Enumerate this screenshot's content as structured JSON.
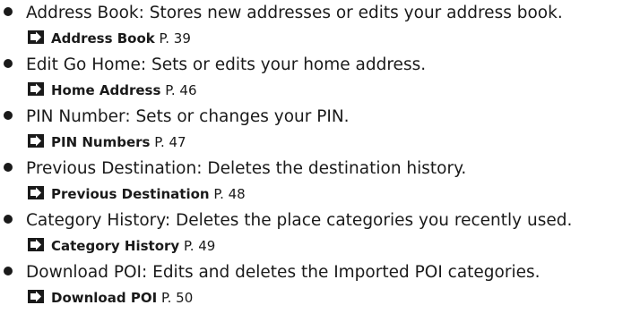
{
  "items": [
    {
      "term": "Address Book",
      "description": ": Stores new addresses or edits your address book.",
      "ref_title": "Address Book",
      "ref_page": "P. 39"
    },
    {
      "term": "Edit Go Home",
      "description": ": Sets or edits your home address.",
      "ref_title": "Home Address",
      "ref_page": "P. 46"
    },
    {
      "term": "PIN Number",
      "description": ": Sets or changes your PIN.",
      "ref_title": "PIN Numbers",
      "ref_page": "P. 47"
    },
    {
      "term": "Previous Destination",
      "description": ": Deletes the destination history.",
      "ref_title": "Previous Destination",
      "ref_page": "P. 48"
    },
    {
      "term": "Category History",
      "description": ": Deletes the place categories you recently used.",
      "ref_title": "Category History",
      "ref_page": "P. 49"
    },
    {
      "term": "Download POI",
      "description": ": Edits and deletes the Imported POI categories.",
      "ref_title": "Download POI",
      "ref_page": "P. 50"
    }
  ],
  "icons": {
    "bullet": "bullet-dot-icon",
    "reference": "reference-arrow-icon"
  },
  "colors": {
    "text": "#1a1a1a",
    "background": "#ffffff"
  }
}
